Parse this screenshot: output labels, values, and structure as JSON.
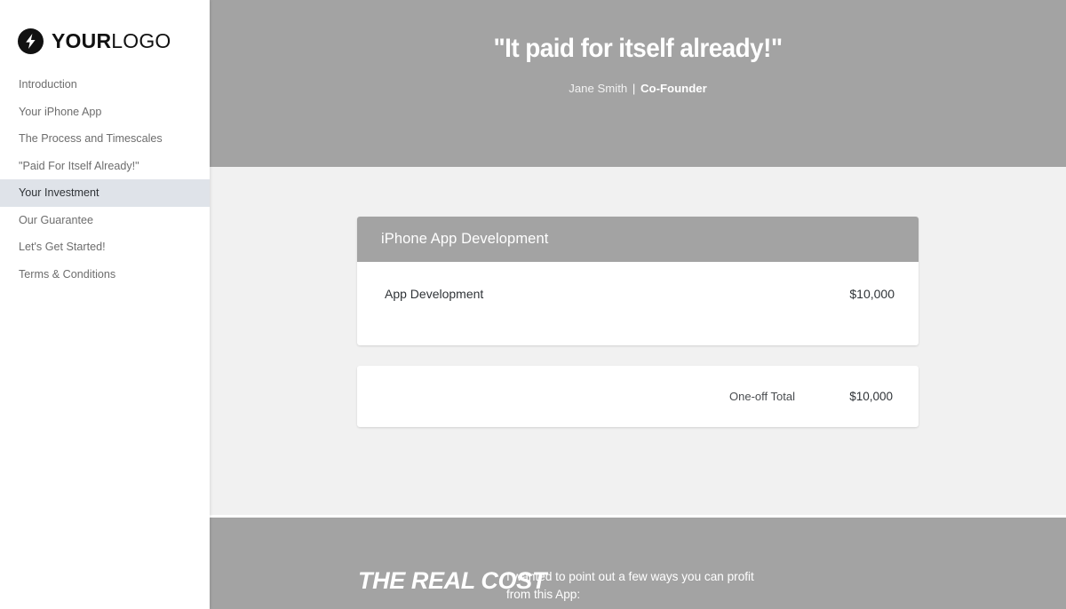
{
  "sidebar": {
    "logo": {
      "icon": "lightning-bolt-icon",
      "bold_part": "YOUR",
      "light_part": "LOGO"
    },
    "items": [
      {
        "label": "Introduction",
        "active": false
      },
      {
        "label": "Your iPhone App",
        "active": false
      },
      {
        "label": "The Process and Timescales",
        "active": false
      },
      {
        "label": "\"Paid For Itself Already!\"",
        "active": false
      },
      {
        "label": "Your Investment",
        "active": true
      },
      {
        "label": "Our Guarantee",
        "active": false
      },
      {
        "label": "Let's Get Started!",
        "active": false
      },
      {
        "label": "Terms & Conditions",
        "active": false
      }
    ]
  },
  "hero": {
    "quote": "\"It paid for itself already!\"",
    "author": "Jane Smith",
    "separator": "|",
    "role": "Co-Founder",
    "background_color": "#a3a3a3"
  },
  "pricing": {
    "card_title": "iPhone App Development",
    "items": [
      {
        "name": "App Development",
        "price": "$10,000"
      }
    ],
    "totals": [
      {
        "label": "One-off Total",
        "value": "$10,000"
      }
    ],
    "section_background": "#f1f1f1"
  },
  "real_cost": {
    "title": "THE REAL COST",
    "body": "I wanted to point out a few ways you can profit from this App:",
    "background_color": "#a3a3a3"
  },
  "colors": {
    "accent_gray": "#a3a3a3",
    "content_bg": "#f1f1f1",
    "active_nav": "#dfe3e9",
    "text_dark": "#2f3337",
    "text_muted": "#6d6d6d"
  }
}
